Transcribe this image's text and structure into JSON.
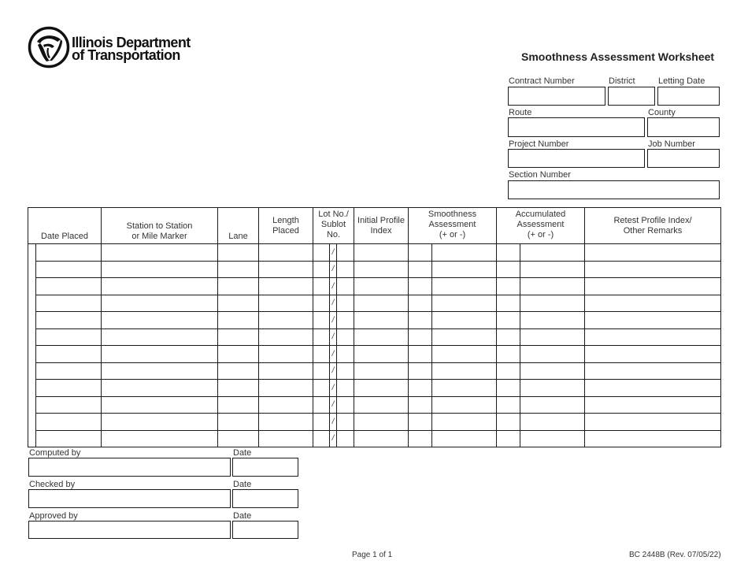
{
  "header": {
    "logo_line1": "Illinois Department",
    "logo_line2": "of Transportation",
    "title": "Smoothness Assessment Worksheet"
  },
  "info_fields": {
    "contract_number": {
      "label": "Contract Number",
      "value": ""
    },
    "district": {
      "label": "District",
      "value": ""
    },
    "letting_date": {
      "label": "Letting Date",
      "value": ""
    },
    "route": {
      "label": "Route",
      "value": ""
    },
    "county": {
      "label": "County",
      "value": ""
    },
    "project_number": {
      "label": "Project Number",
      "value": ""
    },
    "job_number": {
      "label": "Job Number",
      "value": ""
    },
    "section_number": {
      "label": "Section Number",
      "value": ""
    }
  },
  "table": {
    "columns": [
      {
        "key": "date_placed",
        "label": "Date Placed"
      },
      {
        "key": "station",
        "label": "Station to Station\nor Mile Marker"
      },
      {
        "key": "lane",
        "label": "Lane"
      },
      {
        "key": "length",
        "label": "Length\nPlaced"
      },
      {
        "key": "lot",
        "label": "Lot No./\nSublot\nNo."
      },
      {
        "key": "ipi",
        "label": "Initial Profile\nIndex"
      },
      {
        "key": "smoothness",
        "label": "Smoothness\nAssessment\n(+ or -)"
      },
      {
        "key": "accumulated",
        "label": "Accumulated\nAssessment\n(+ or -)"
      },
      {
        "key": "remarks",
        "label": "Retest Profile Index/\nOther Remarks"
      }
    ],
    "lot_separator": "/",
    "row_count": 12
  },
  "signatures": [
    {
      "label": "Computed by",
      "date_label": "Date"
    },
    {
      "label": "Checked by",
      "date_label": "Date"
    },
    {
      "label": "Approved by",
      "date_label": "Date"
    }
  ],
  "footer": {
    "page": "Page 1 of 1",
    "form_id": "BC 2448B (Rev. 07/05/22)"
  }
}
